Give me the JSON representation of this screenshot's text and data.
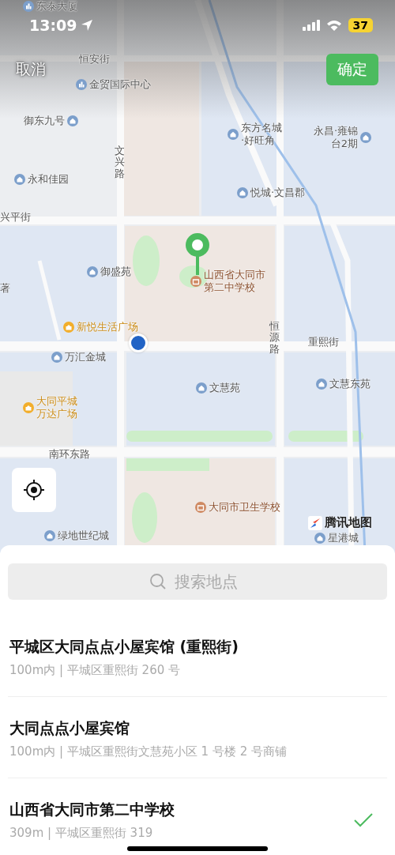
{
  "status_bar": {
    "time": "13:09",
    "battery": "37"
  },
  "header": {
    "cancel": "取消",
    "confirm": "确定"
  },
  "map": {
    "labels": [
      {
        "kind": "office",
        "text": "东泰大厦"
      },
      {
        "kind": "road",
        "text": "恒安街"
      },
      {
        "kind": "office",
        "text": "金贸国际中心"
      },
      {
        "kind": "residence",
        "text": "御东九号"
      },
      {
        "kind": "residence",
        "text": "东方名城·好旺角"
      },
      {
        "kind": "residence",
        "text": "永昌·雍锦台2期"
      },
      {
        "kind": "road-vertical",
        "text": "文兴路"
      },
      {
        "kind": "residence",
        "text": "永和佳园"
      },
      {
        "kind": "residence",
        "text": "悦城·文昌郡"
      },
      {
        "kind": "road",
        "text": "兴平街"
      },
      {
        "kind": "residence",
        "text": "御盛苑"
      },
      {
        "kind": "road",
        "text": "著"
      },
      {
        "kind": "school",
        "text": "山西省大同市第二中学校"
      },
      {
        "kind": "mall",
        "text": "新悦生活广场"
      },
      {
        "kind": "road-vertical",
        "text": "恒源路"
      },
      {
        "kind": "road",
        "text": "重熙街"
      },
      {
        "kind": "residence",
        "text": "万汇金城"
      },
      {
        "kind": "residence",
        "text": "文慧苑"
      },
      {
        "kind": "residence",
        "text": "文慧东苑"
      },
      {
        "kind": "mall",
        "text": "大同平城万达广场"
      },
      {
        "kind": "road",
        "text": "南环东路"
      },
      {
        "kind": "school",
        "text": "大同市卫生学校"
      },
      {
        "kind": "residence",
        "text": "绿地世纪城"
      },
      {
        "kind": "residence",
        "text": "星港城"
      }
    ],
    "attribution": "腾讯地图"
  },
  "search": {
    "placeholder": "搜索地点"
  },
  "results": [
    {
      "title": "平城区大同点点小屋宾馆 (重熙街)",
      "detail": "100m内 | 平城区重熙街 260 号",
      "selected": false
    },
    {
      "title": "大同点点小屋宾馆",
      "detail": "100m内 | 平城区重熙街文慧苑小区 1 号楼 2 号商铺",
      "selected": false
    },
    {
      "title": "山西省大同市第二中学校",
      "detail": "309m | 平城区重熙街 319",
      "selected": true
    }
  ]
}
